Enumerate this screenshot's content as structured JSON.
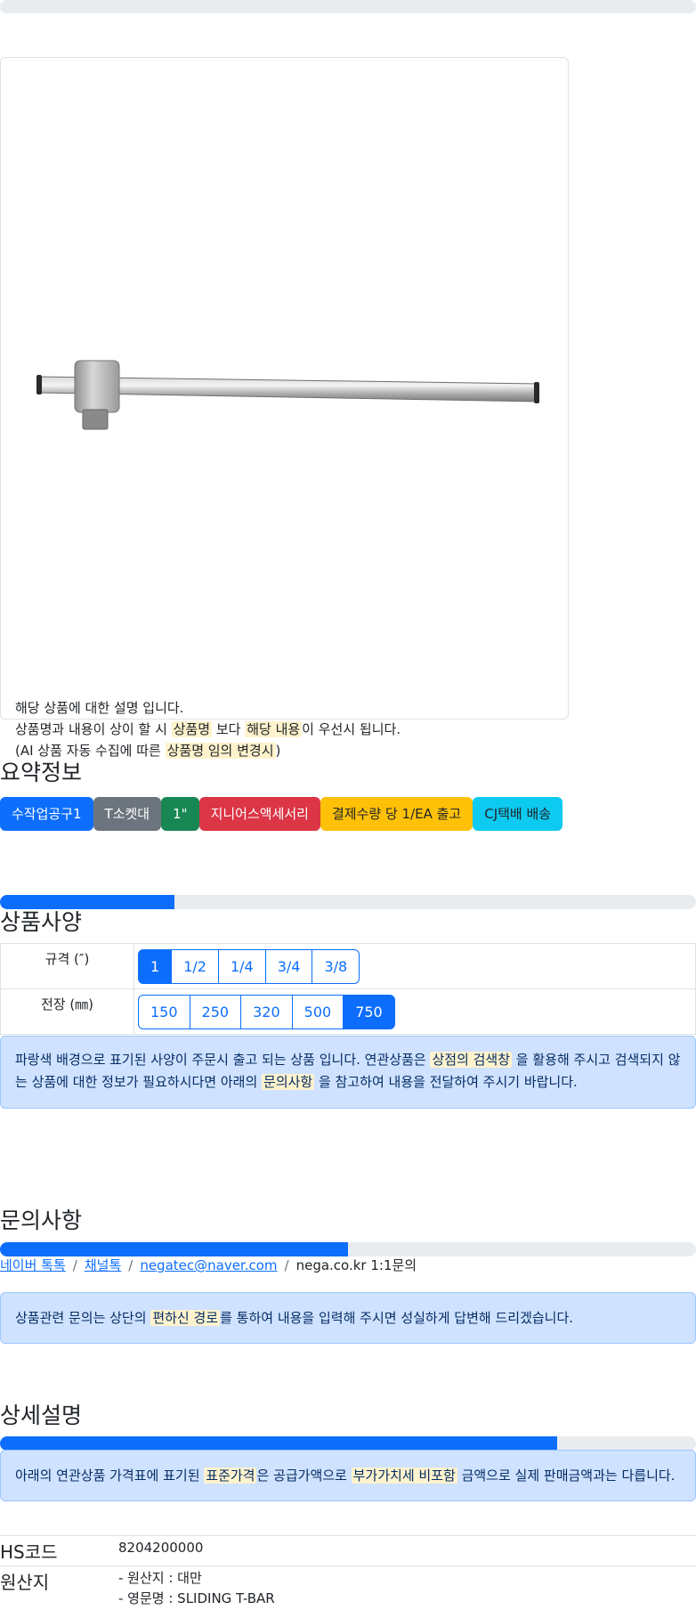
{
  "progress": {
    "top_bar": 0.0,
    "specs_bar": 0.25,
    "inquiry_bar": 0.5,
    "detail_bar": 0.8
  },
  "product": {
    "image_icon": "t-socket-bar-image",
    "description": {
      "line1": "해당 상품에 대한 설명 입니다.",
      "line2_a": "상품명과 내용이 상이 할 시 ",
      "line2_hl1": "상품명",
      "line2_b": " 보다 ",
      "line2_hl2": "해당 내용",
      "line2_c": "이 우선시 됩니다.",
      "line3_a": "(AI 상품 자동 수집에 따른 ",
      "line3_hl": "상품명 임의 변경시",
      "line3_b": ")"
    }
  },
  "summary": {
    "title": "요약정보",
    "badges": [
      "수작업공구1",
      "T소켓대",
      "1\"",
      "지니어스액세서리",
      "결제수량 당 1/EA 출고",
      "CJ택배 배송"
    ]
  },
  "specs": {
    "title": "상품사양",
    "rows": [
      {
        "label": "규격 (″)",
        "options": [
          "1",
          "1/2",
          "1/4",
          "3/4",
          "3/8"
        ],
        "selected": "1"
      },
      {
        "label": "전장 (㎜)",
        "options": [
          "150",
          "250",
          "320",
          "500",
          "750"
        ],
        "selected": "750"
      }
    ],
    "notice": {
      "a": "파랑색 배경으로 표기된 사양이 주문시 출고 되는 상품 입니다. 연관상품은 ",
      "hl1": "상점의 검색창",
      "b": " 을 활용해 주시고 검색되지 않는 상품에 대한 정보가 필요하시다면 아래의 ",
      "hl2": "문의사항",
      "c": " 을 참고하여 내용을 전달하여 주시기 바랍니다."
    }
  },
  "inquiry": {
    "title": "문의사항",
    "links": [
      "네이버 톡톡",
      "채널톡",
      "negatec@naver.com"
    ],
    "separator": "/",
    "plain": "nega.co.kr 1:1문의",
    "notice": {
      "a": "상품관련 문의는 상단의 ",
      "hl": "편하신 경로",
      "b": "를 통하여 내용을 입력해 주시면 성실하게 답변해 드리겠습니다."
    }
  },
  "detail": {
    "title": "상세설명",
    "notice": {
      "a": "아래의 연관상품 가격표에 표기된 ",
      "hl1": "표준가격",
      "b": "은 공급가액으로 ",
      "hl2": "부가가치세 비포함",
      "c": " 금액으로 실제 판매금액과는 다릅니다."
    },
    "info": [
      {
        "key": "HS코드",
        "values": [
          "8204200000"
        ]
      },
      {
        "key": "원산지",
        "values": [
          "- 원산지 : 대만",
          "- 영문명 : SLIDING T-BAR"
        ]
      }
    ]
  },
  "colors": {
    "primary": "#0d6efd",
    "highlight": "#fff3cd",
    "alert_bg": "#cfe2ff"
  }
}
